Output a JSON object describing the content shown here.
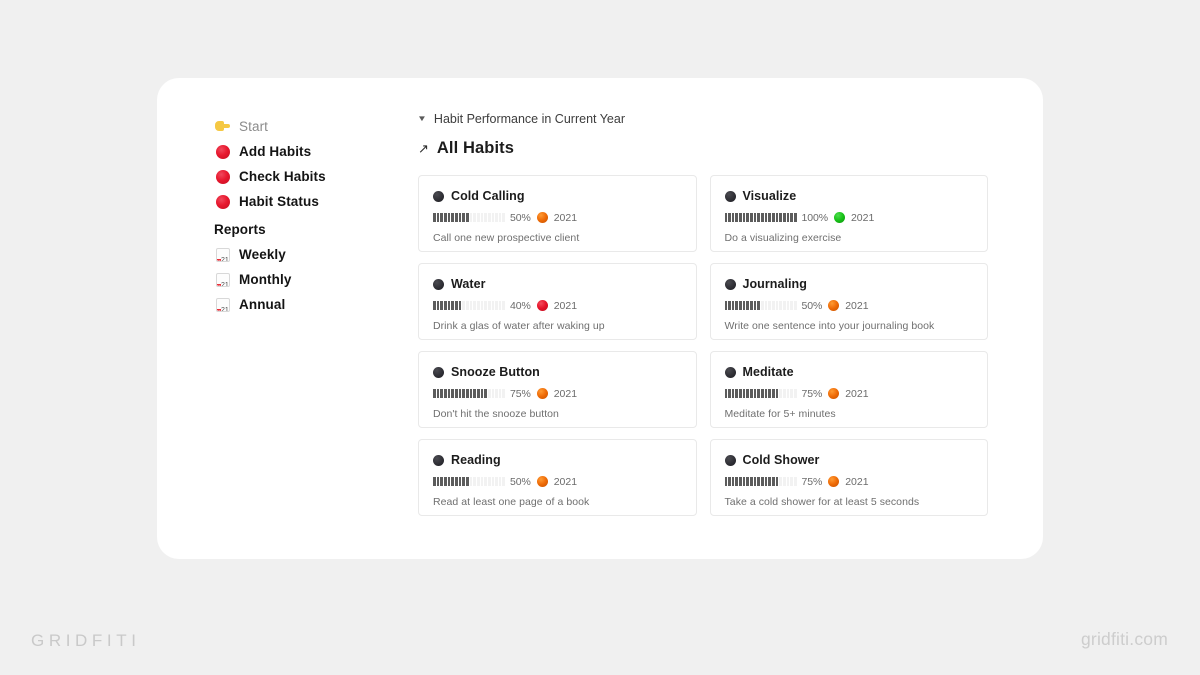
{
  "page": {
    "background_color": "#f0f0f0",
    "panel_color": "#ffffff"
  },
  "sidebar": {
    "items": [
      {
        "label": "Start",
        "icon": "pointing-hand-icon",
        "type": "link",
        "muted": true
      },
      {
        "label": "Add Habits",
        "icon": "red-circle-icon",
        "type": "link",
        "muted": false
      },
      {
        "label": "Check Habits",
        "icon": "red-circle-icon",
        "type": "link",
        "muted": false
      },
      {
        "label": "Habit Status",
        "icon": "red-circle-icon",
        "type": "link",
        "muted": false
      }
    ],
    "section_heading": "Reports",
    "report_items": [
      {
        "label": "Weekly",
        "icon": "calendar-icon",
        "cal_top": "JUL",
        "cal_day": "21"
      },
      {
        "label": "Monthly",
        "icon": "calendar-icon",
        "cal_top": "JUL",
        "cal_day": "21"
      },
      {
        "label": "Annual",
        "icon": "calendar-icon",
        "cal_top": "JUL",
        "cal_day": "21"
      }
    ]
  },
  "header": {
    "caret_icon": "chevron-down-icon",
    "breadcrumb": "Habit Performance in Current Year",
    "title_icon": "arrow-up-right-icon",
    "title": "All Habits"
  },
  "habits": [
    {
      "name": "Cold Calling",
      "percent": 50,
      "percent_label": "50%",
      "year": "2021",
      "status_color": "orange",
      "description": "Call one new prospective client"
    },
    {
      "name": "Visualize",
      "percent": 100,
      "percent_label": "100%",
      "year": "2021",
      "status_color": "green",
      "description": "Do a visualizing exercise"
    },
    {
      "name": "Water",
      "percent": 40,
      "percent_label": "40%",
      "year": "2021",
      "status_color": "red",
      "description": "Drink a glas of water after waking up"
    },
    {
      "name": "Journaling",
      "percent": 50,
      "percent_label": "50%",
      "year": "2021",
      "status_color": "orange",
      "description": "Write one sentence into your journaling book"
    },
    {
      "name": "Snooze Button",
      "percent": 75,
      "percent_label": "75%",
      "year": "2021",
      "status_color": "orange",
      "description": "Don't hit the snooze button"
    },
    {
      "name": "Meditate",
      "percent": 75,
      "percent_label": "75%",
      "year": "2021",
      "status_color": "orange",
      "description": "Meditate for 5+ minutes"
    },
    {
      "name": "Reading",
      "percent": 50,
      "percent_label": "50%",
      "year": "2021",
      "status_color": "orange",
      "description": "Read at least one page of a book"
    },
    {
      "name": "Cold Shower",
      "percent": 75,
      "percent_label": "75%",
      "year": "2021",
      "status_color": "orange",
      "description": "Take a cold shower for at least 5 seconds"
    }
  ],
  "watermarks": {
    "left": "GRIDFITI",
    "right": "gridfiti.com"
  }
}
